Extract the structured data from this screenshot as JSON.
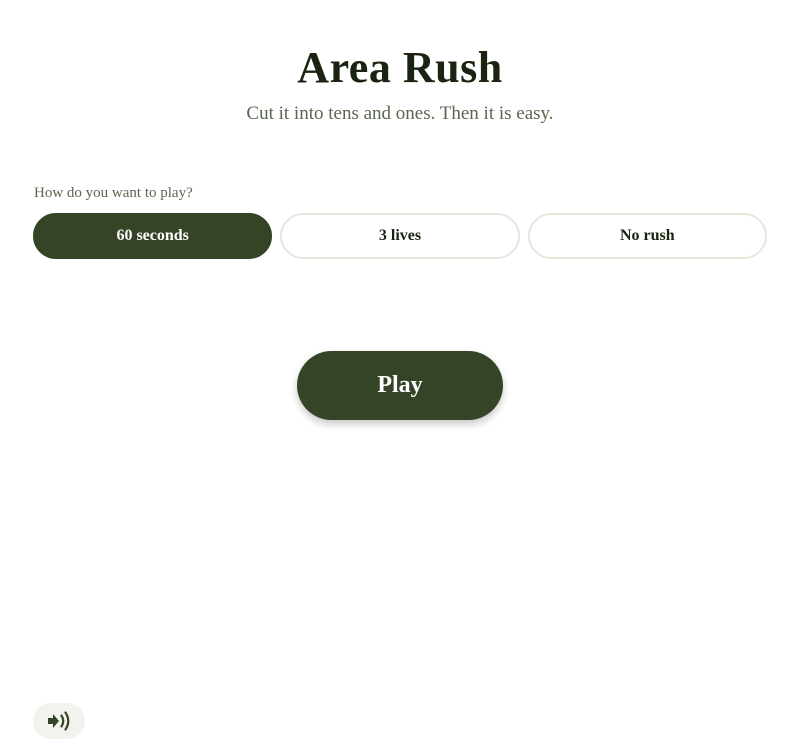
{
  "header": {
    "title": "Area Rush",
    "subtitle": "Cut it into tens and ones. Then it is easy."
  },
  "mode": {
    "prompt": "How do you want to play?",
    "options": [
      {
        "label": "60 seconds",
        "selected": true
      },
      {
        "label": "3 lives",
        "selected": false
      },
      {
        "label": "No rush",
        "selected": false
      }
    ]
  },
  "actions": {
    "play_label": "Play"
  },
  "sound": {
    "icon": "speaker-icon",
    "state": "on"
  },
  "colors": {
    "accent": "#354426",
    "border": "#e8e6dc",
    "muted_text": "#5b6650",
    "sound_bg": "#f3f3ee"
  }
}
